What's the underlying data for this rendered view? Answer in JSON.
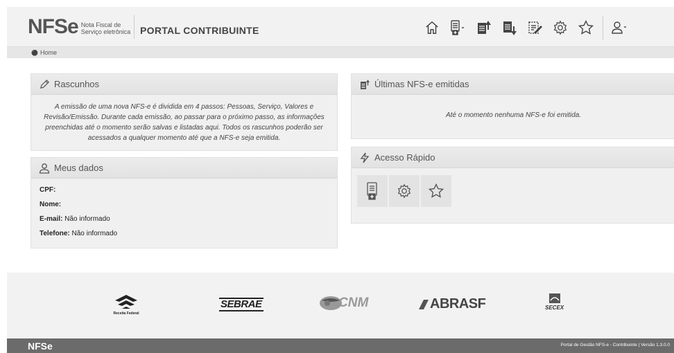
{
  "header": {
    "logo_big": "NFSe",
    "logo_small_line1": "Nota Fiscal de",
    "logo_small_line2": "Serviço eletrônica",
    "portal_title": "PORTAL CONTRIBUINTE",
    "nav_icons": [
      "home-icon",
      "new-nfse-icon",
      "issued-upload-icon",
      "received-download-icon",
      "drafts-icon",
      "settings-icon",
      "favorites-icon",
      "user-icon"
    ]
  },
  "breadcrumb": {
    "home": "Home"
  },
  "rascunhos": {
    "title": "Rascunhos",
    "text": "A emissão de uma nova NFS-e é dividida em 4 passos: Pessoas, Serviço, Valores e Revisão/Emissão. Durante cada emissão, ao passar para o próximo passo, as informações preenchidas até o momento serão salvas e listadas aqui. Todos os rascunhos poderão ser acessados a qualquer momento até que a NFS-e seja emitida."
  },
  "meus_dados": {
    "title": "Meus dados",
    "cpf_label": "CPF:",
    "cpf_value": "",
    "nome_label": "Nome:",
    "nome_value": "",
    "email_label": "E-mail:",
    "email_value": "Não informado",
    "telefone_label": "Telefone:",
    "telefone_value": "Não informado"
  },
  "ultimas": {
    "title": "Últimas NFS-e emitidas",
    "empty_text": "Até o momento nenhuma NFS-e foi emitida."
  },
  "acesso_rapido": {
    "title": "Acesso Rápido",
    "items": [
      "new-nfse-icon",
      "settings-icon",
      "favorites-icon"
    ]
  },
  "footer": {
    "partners": [
      "Receita Federal",
      "SEBRAE",
      "CNM",
      "ABRASF",
      "SECEX"
    ],
    "bottom_logo": "NFSe",
    "version_text": "Portal de Gestão NFS-e - Contribuinte | Versão 1.3.0.0"
  }
}
